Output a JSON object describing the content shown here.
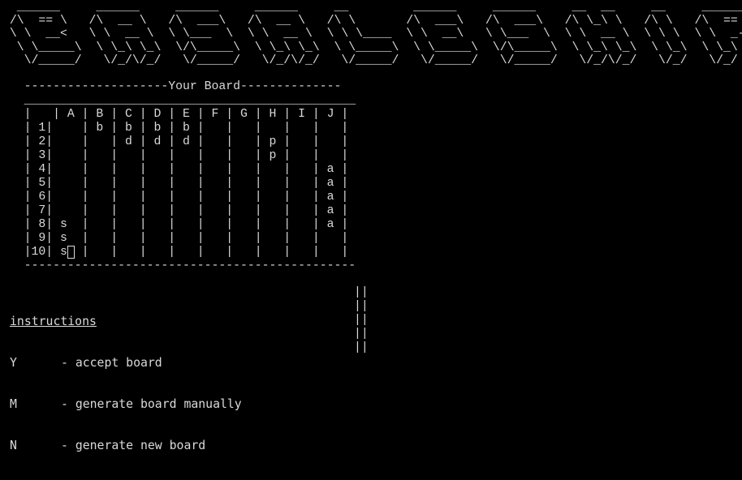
{
  "banner": {
    "art": "  ______     ______     ______     ______     __         ______     ______     __  __     __     ______  \n /\\  == \\   /\\  __ \\   /\\  ___\\   /\\  __ \\   /\\ \\       /\\  ___\\   /\\  ___\\   /\\ \\_\\ \\   /\\ \\   /\\  == \\ \n \\ \\  __<   \\ \\  __ \\  \\ \\___  \\  \\ \\  __ \\  \\ \\ \\____  \\ \\  __\\   \\ \\___  \\  \\ \\  __ \\  \\ \\ \\  \\ \\  _-/ \n  \\ \\_____\\  \\ \\_\\ \\_\\  \\/\\_____\\  \\ \\_\\ \\_\\  \\ \\_____\\  \\ \\_____\\  \\/\\_____\\  \\ \\_\\ \\_\\  \\ \\_\\  \\ \\_\\   \n   \\/_____/   \\/_/\\/_/   \\/_____/   \\/_/\\/_/   \\/_____/   \\/_____/   \\/_____/   \\/_/\\/_/   \\/_/   \\/_/   "
  },
  "board": {
    "text": "   --------------------Your Board--------------\n   ______________________________________________\n   |   | A | B | C | D | E | F | G | H | I | J |\n   | 1|    | b | b | b | b |   |   |   |   |   |\n   | 2|    |   | d | d | d |   |   | p |   |   |\n   | 3|    |   |   |   |   |   |   | p |   |   |\n   | 4|    |   |   |   |   |   |   |   |   | a |\n   | 5|    |   |   |   |   |   |   |   |   | a |\n   | 6|    |   |   |   |   |   |   |   |   | a |\n   | 7|    |   |   |   |   |   |   |   |   | a |\n   | 8| s  |   |   |   |   |   |   |   |   | a |\n   | 9| s  |   |   |   |   |   |   |   |   |   |\n   |10| s  |   |   |   |   |   |   |   |   |   |\n   ----------------------------------------------"
  },
  "side_bar": {
    "text": "||\n||\n||\n||\n||"
  },
  "instructions": {
    "title": "instructions",
    "items": [
      {
        "key": "Y",
        "label": "- accept board"
      },
      {
        "key": "M",
        "label": "- generate board manually"
      },
      {
        "key": "N",
        "label": "- generate new board"
      }
    ]
  }
}
